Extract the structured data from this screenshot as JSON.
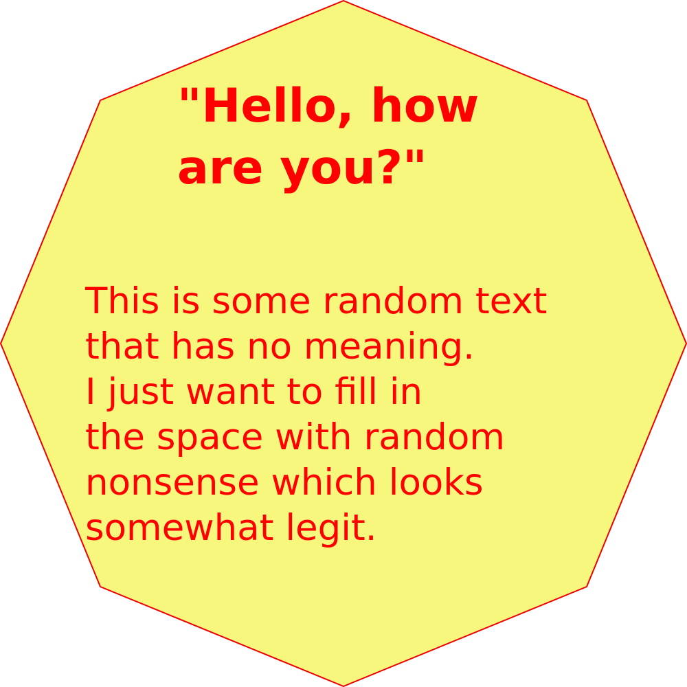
{
  "colors": {
    "fill": "#f7f77e",
    "stroke": "#ee0000",
    "text": "#ff0000",
    "background": "#ffffff"
  },
  "shape": "octagon",
  "heading": {
    "lines": [
      "\"Hello, how",
      "are you?\""
    ]
  },
  "body": {
    "lines": [
      "This is some random text",
      "that has no meaning.",
      "I just want to fill in",
      "the space with random",
      "nonsense which looks",
      "somewhat legit."
    ]
  }
}
